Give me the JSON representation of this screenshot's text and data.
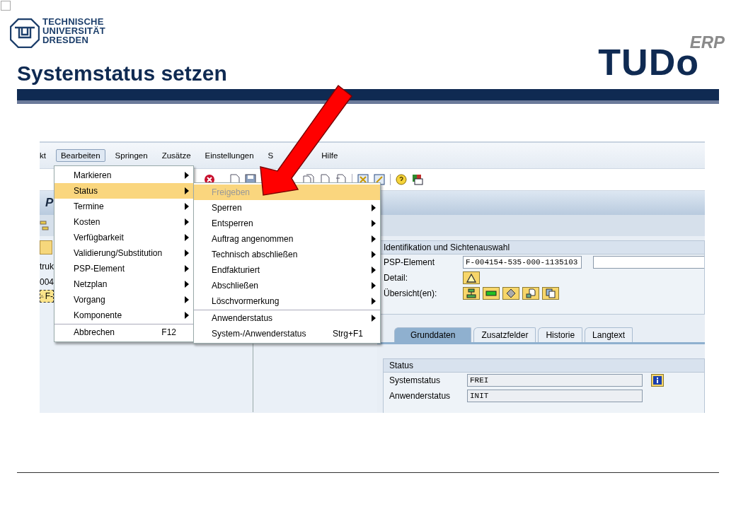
{
  "header": {
    "university": [
      "TECHNISCHE",
      "UNIVERSITÄT",
      "DRESDEN"
    ],
    "brand": "TUDo",
    "brand_sup": "ERP",
    "title": "Systemstatus setzen"
  },
  "sap": {
    "menu_bar": [
      {
        "label": "kt",
        "selected": false
      },
      {
        "label": "Bearbeiten",
        "selected": true
      },
      {
        "label": "Springen",
        "selected": false
      },
      {
        "label": "Zusätze",
        "selected": false
      },
      {
        "label": "Einstellungen",
        "selected": false
      },
      {
        "label": "S",
        "selected": false
      },
      {
        "label": "Hilfe",
        "selected": false
      }
    ],
    "screen_title": "P",
    "tree": [
      {
        "label": "truk",
        "kind": "plain"
      },
      {
        "label": "004",
        "kind": "plain"
      },
      {
        "label": "F-",
        "kind": "warning"
      }
    ],
    "menu": [
      {
        "label": "Markieren",
        "submenu": true,
        "selected": false,
        "separator_before": false
      },
      {
        "label": "Status",
        "submenu": true,
        "selected": true,
        "separator_before": false
      },
      {
        "label": "Termine",
        "submenu": true,
        "selected": false,
        "separator_before": false
      },
      {
        "label": "Kosten",
        "submenu": true,
        "selected": false,
        "separator_before": false
      },
      {
        "label": "Verfügbarkeit",
        "submenu": true,
        "selected": false,
        "separator_before": false
      },
      {
        "label": "Validierung/Substitution",
        "submenu": true,
        "selected": false,
        "separator_before": false
      },
      {
        "label": "PSP-Element",
        "submenu": true,
        "selected": false,
        "separator_before": false
      },
      {
        "label": "Netzplan",
        "submenu": true,
        "selected": false,
        "separator_before": false
      },
      {
        "label": "Vorgang",
        "submenu": true,
        "selected": false,
        "separator_before": false
      },
      {
        "label": "Komponente",
        "submenu": true,
        "selected": false,
        "separator_before": false
      },
      {
        "label": "Abbrechen",
        "shortcut": "F12",
        "submenu": false,
        "selected": false,
        "separator_before": true
      }
    ],
    "submenu": [
      {
        "label": "Freigeben",
        "submenu": false,
        "selected": true,
        "disabled": true,
        "separator_before": false
      },
      {
        "label": "Sperren",
        "submenu": true,
        "selected": false,
        "disabled": false,
        "separator_before": false
      },
      {
        "label": "Entsperren",
        "submenu": true,
        "selected": false,
        "disabled": false,
        "separator_before": false
      },
      {
        "label": "Auftrag angenommen",
        "submenu": true,
        "selected": false,
        "disabled": false,
        "separator_before": false
      },
      {
        "label": "Technisch abschließen",
        "submenu": true,
        "selected": false,
        "disabled": false,
        "separator_before": false
      },
      {
        "label": "Endfakturiert",
        "submenu": true,
        "selected": false,
        "disabled": false,
        "separator_before": false
      },
      {
        "label": "Abschließen",
        "submenu": true,
        "selected": false,
        "disabled": false,
        "separator_before": false
      },
      {
        "label": "Löschvormerkung",
        "submenu": true,
        "selected": false,
        "disabled": false,
        "separator_before": false
      },
      {
        "label": "Anwenderstatus",
        "submenu": true,
        "selected": false,
        "disabled": false,
        "separator_before": true
      },
      {
        "label": "System-/Anwenderstatus",
        "shortcut": "Strg+F1",
        "submenu": false,
        "selected": false,
        "disabled": false,
        "separator_before": false
      }
    ],
    "identification": {
      "title": "Identifikation und Sichtenauswahl",
      "psp_label": "PSP-Element",
      "psp_value": "F-004154-535-000-1135103",
      "detail_label": "Detail:",
      "overview_label": "Übersicht(en):"
    },
    "tabs": [
      {
        "label": "Grunddaten",
        "selected": true
      },
      {
        "label": "Zusatzfelder",
        "selected": false
      },
      {
        "label": "Historie",
        "selected": false
      },
      {
        "label": "Langtext",
        "selected": false
      }
    ],
    "status_group": {
      "title": "Status",
      "rows": [
        {
          "label": "Systemstatus",
          "value": "FREI",
          "info": true
        },
        {
          "label": "Anwenderstatus",
          "value": "INIT",
          "info": false
        }
      ]
    }
  }
}
